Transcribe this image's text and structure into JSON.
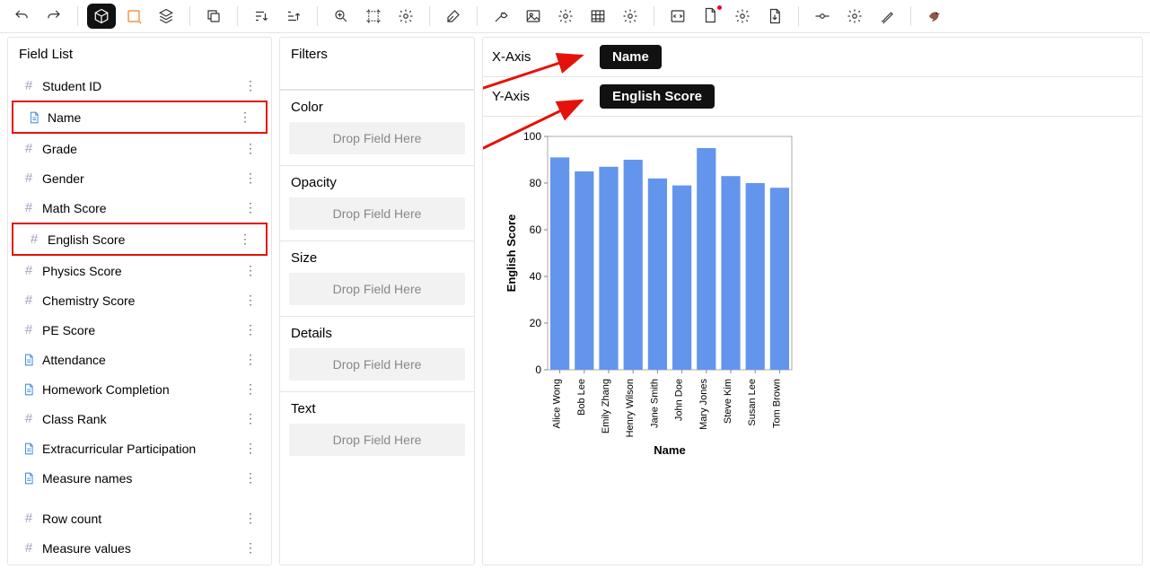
{
  "toolbar": {
    "undo": "undo",
    "redo": "redo",
    "cube": "cube",
    "polygon": "polygon",
    "layers": "layers",
    "copy": "copy",
    "sort": "sort",
    "sort2": "sort2",
    "zoom": "zoom",
    "crop": "crop",
    "gear1": "gear1",
    "paint": "paint",
    "wrench": "wrench",
    "image": "image",
    "gear2": "gear2",
    "table": "table",
    "gear3": "gear3",
    "code": "code",
    "doc": "doc",
    "gear4": "gear4",
    "download": "download",
    "commit": "commit",
    "gear5": "gear5",
    "brush": "brush",
    "bird": "bird"
  },
  "fieldList": {
    "title": "Field List",
    "items": [
      {
        "label": "Student ID",
        "type": "hash"
      },
      {
        "label": "Name",
        "type": "doc",
        "highlight": true
      },
      {
        "label": "Grade",
        "type": "hash"
      },
      {
        "label": "Gender",
        "type": "hash"
      },
      {
        "label": "Math Score",
        "type": "hash"
      },
      {
        "label": "English Score",
        "type": "hash",
        "highlight": true
      },
      {
        "label": "Physics Score",
        "type": "hash"
      },
      {
        "label": "Chemistry Score",
        "type": "hash"
      },
      {
        "label": "PE Score",
        "type": "hash"
      },
      {
        "label": "Attendance",
        "type": "doc"
      },
      {
        "label": "Homework Completion",
        "type": "doc"
      },
      {
        "label": "Class Rank",
        "type": "hash"
      },
      {
        "label": "Extracurricular Participation",
        "type": "doc"
      },
      {
        "label": "Measure names",
        "type": "doc"
      }
    ],
    "extras": [
      {
        "label": "Row count",
        "type": "hash"
      },
      {
        "label": "Measure values",
        "type": "hash"
      }
    ]
  },
  "shelves": {
    "filters": "Filters",
    "color": "Color",
    "opacity": "Opacity",
    "size": "Size",
    "details": "Details",
    "text": "Text",
    "dropHint": "Drop Field Here"
  },
  "axes": {
    "xLabel": "X-Axis",
    "xChip": "Name",
    "yLabel": "Y-Axis",
    "yChip": "English Score"
  },
  "chart_data": {
    "type": "bar",
    "title": "",
    "xlabel": "Name",
    "ylabel": "English Score",
    "ylim": [
      0,
      100
    ],
    "yticks": [
      0,
      20,
      40,
      60,
      80,
      100
    ],
    "categories": [
      "Alice Wong",
      "Bob Lee",
      "Emily Zhang",
      "Henry Wilson",
      "Jane Smith",
      "John Doe",
      "Mary Jones",
      "Steve Kim",
      "Susan Lee",
      "Tom Brown"
    ],
    "values": [
      91,
      85,
      87,
      90,
      82,
      79,
      95,
      83,
      80,
      78
    ],
    "barColor": "#6495ed"
  }
}
